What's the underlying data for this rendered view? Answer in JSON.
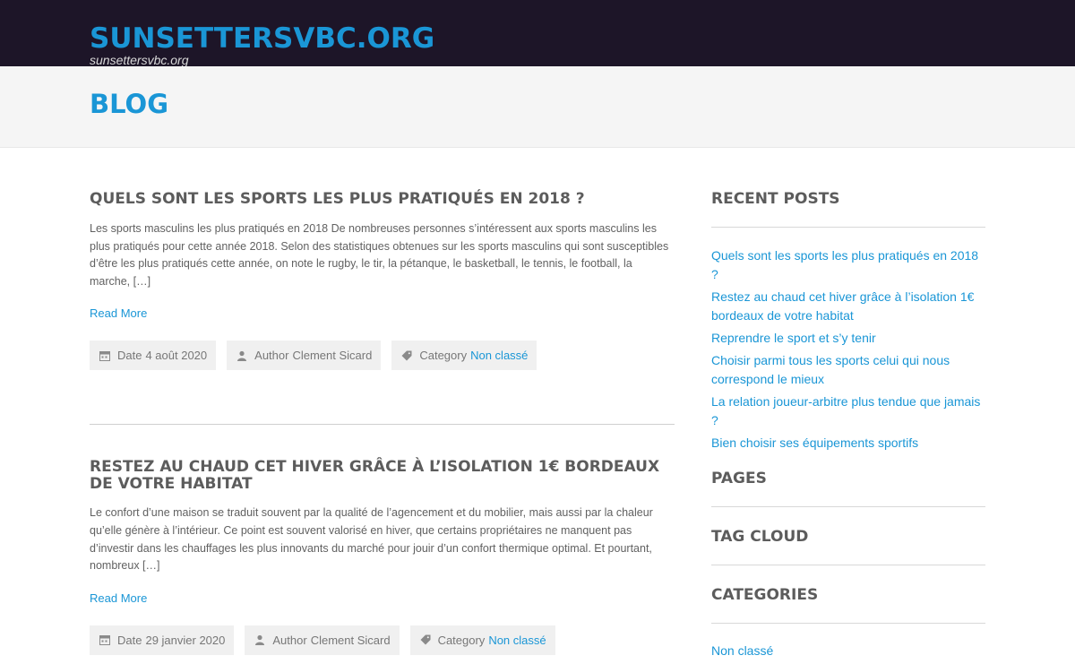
{
  "header": {
    "site_title": "SUNSETTERSVBC.ORG",
    "tagline": "sunsettersvbc.org"
  },
  "page": {
    "title": "BLOG"
  },
  "posts": [
    {
      "title": "QUELS SONT LES SPORTS LES PLUS PRATIQUÉS EN 2018 ?",
      "excerpt": "Les sports masculins les plus pratiqués en 2018 De nombreuses personnes s’intéressent aux sports masculins les plus pratiqués pour cette année 2018. Selon des statistiques obtenues sur les sports masculins qui sont susceptibles d’être les plus pratiqués cette année, on note le rugby, le tir, la pétanque, le basketball, le tennis, le football, la marche, […]",
      "read_more": "Read More",
      "date_label": "Date",
      "date": "4 août 2020",
      "author_label": "Author",
      "author": "Clement Sicard",
      "category_label": "Category",
      "category": "Non classé"
    },
    {
      "title": "RESTEZ AU CHAUD CET HIVER GRÂCE À L’ISOLATION 1€ BORDEAUX DE VOTRE HABITAT",
      "excerpt": "Le confort d’une maison se traduit souvent par la qualité de l’agencement et du mobilier, mais aussi par la chaleur qu’elle génère à l’intérieur. Ce point est souvent valorisé en hiver, que certains propriétaires ne manquent pas d’investir dans les chauffages les plus innovants du marché pour jouir d’un confort thermique optimal. Et pourtant, nombreux […]",
      "read_more": "Read More",
      "date_label": "Date",
      "date": "29 janvier 2020",
      "author_label": "Author",
      "author": "Clement Sicard",
      "category_label": "Category",
      "category": "Non classé"
    }
  ],
  "sidebar": {
    "recent_posts_title": "RECENT POSTS",
    "recent_posts": [
      "Quels sont les sports les plus pratiqués en 2018 ?",
      "Restez au chaud cet hiver grâce à l’isolation 1€ bordeaux de votre habitat",
      "Reprendre le sport et s’y tenir",
      "Choisir parmi tous les sports celui qui nous correspond le mieux",
      "La relation joueur-arbitre plus tendue que jamais ?",
      "Bien choisir ses équipements sportifs"
    ],
    "pages_title": "PAGES",
    "tag_cloud_title": "TAG CLOUD",
    "categories_title": "CATEGORIES",
    "categories": [
      "Non classé"
    ]
  },
  "colors": {
    "header_bg": "#1d1528",
    "accent": "#1a96d6",
    "title_band_bg": "#f5f5f5",
    "meta_bg": "#f0f0f0"
  },
  "icons": {
    "date": "calendar-icon",
    "author": "user-icon",
    "category": "tag-icon"
  }
}
